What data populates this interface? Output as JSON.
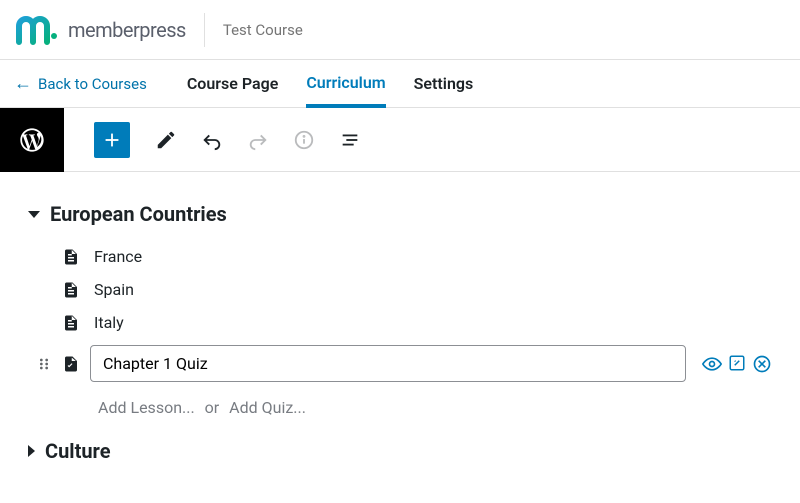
{
  "brand": "memberpress",
  "course_title": "Test Course",
  "back_label": "Back to Courses",
  "tabs": {
    "course_page": "Course Page",
    "curriculum": "Curriculum",
    "settings": "Settings"
  },
  "colors": {
    "accent": "#007cba",
    "muted": "#787c82"
  },
  "sections": [
    {
      "title": "European Countries",
      "expanded": true,
      "lessons": [
        "France",
        "Spain",
        "Italy"
      ]
    },
    {
      "title": "Culture",
      "expanded": false,
      "lessons": []
    }
  ],
  "editing_quiz": {
    "value": "Chapter 1 Quiz"
  },
  "add_row": {
    "add_lesson": "Add Lesson...",
    "or": "or",
    "add_quiz": "Add Quiz..."
  }
}
